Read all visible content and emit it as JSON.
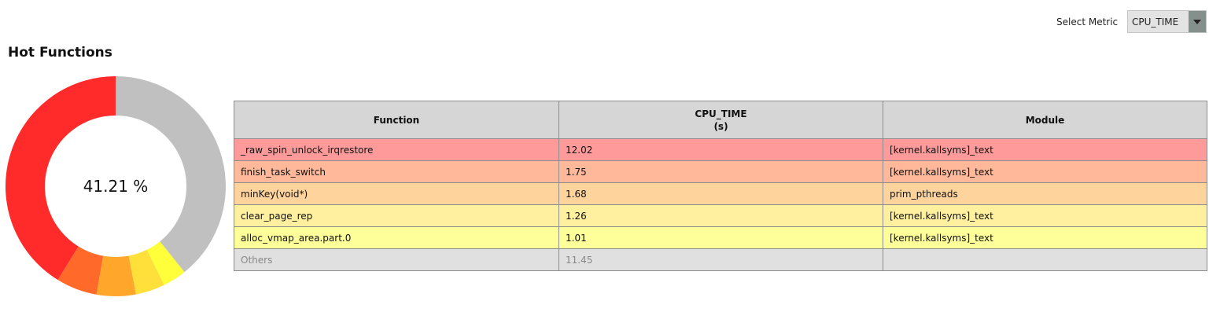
{
  "toolbar": {
    "select_label": "Select Metric",
    "selected_metric": "CPU_TIME"
  },
  "section": {
    "title": "Hot Functions"
  },
  "donut": {
    "center_label": "41.21 %",
    "slices": [
      {
        "name": "_raw_spin_unlock_irqrestore",
        "value": 12.02,
        "color": "#ff2b2b"
      },
      {
        "name": "finish_task_switch",
        "value": 1.75,
        "color": "#ff6a2b"
      },
      {
        "name": "minKey(void*)",
        "value": 1.68,
        "color": "#ffa62b"
      },
      {
        "name": "clear_page_rep",
        "value": 1.26,
        "color": "#ffe03a"
      },
      {
        "name": "alloc_vmap_area.part.0",
        "value": 1.01,
        "color": "#ffff3a"
      },
      {
        "name": "Others",
        "value": 11.45,
        "color": "#c0c0c0"
      }
    ]
  },
  "table": {
    "headers": {
      "function": "Function",
      "metric": "CPU_TIME",
      "unit": "(s)",
      "module": "Module"
    },
    "rows": [
      {
        "function": "_raw_spin_unlock_irqrestore",
        "value": "12.02",
        "module": "[kernel.kallsyms]_text",
        "color": "#fe9a9a"
      },
      {
        "function": "finish_task_switch",
        "value": "1.75",
        "module": "[kernel.kallsyms]_text",
        "color": "#ffb89a"
      },
      {
        "function": "minKey(void*)",
        "value": "1.68",
        "module": "prim_pthreads",
        "color": "#ffd39c"
      },
      {
        "function": "clear_page_rep",
        "value": "1.26",
        "module": "[kernel.kallsyms]_text",
        "color": "#fff0a0"
      },
      {
        "function": "alloc_vmap_area.part.0",
        "value": "1.01",
        "module": "[kernel.kallsyms]_text",
        "color": "#ffff9a"
      },
      {
        "function": "Others",
        "value": "11.45",
        "module": "",
        "color": "#e0e0e0"
      }
    ]
  }
}
